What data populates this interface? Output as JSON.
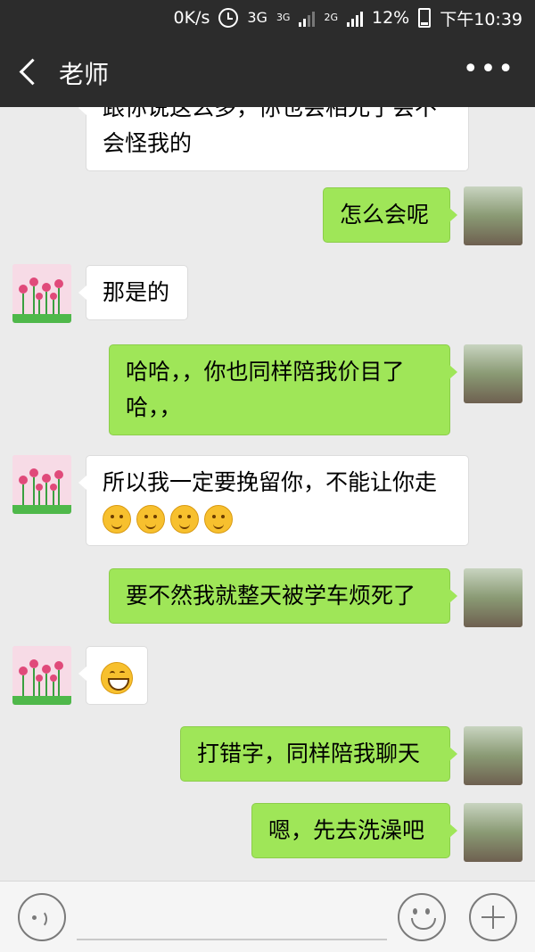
{
  "status_bar": {
    "net_speed": "0K/s",
    "net_a": "3G",
    "net_b": "3G",
    "net_c": "2G",
    "battery": "12%",
    "time": "下午10:39"
  },
  "header": {
    "title": "老师",
    "more": "•••"
  },
  "messages": [
    {
      "side": "in",
      "text_a": "跟你说这么多，你也会相允了会不",
      "text_b": "会怪我的"
    },
    {
      "side": "out",
      "text": "怎么会呢"
    },
    {
      "side": "in",
      "text": "那是的"
    },
    {
      "side": "out",
      "text_a": "哈哈，，你也同样陪我价目了",
      "text_b": "哈，，"
    },
    {
      "side": "in",
      "text": "所以我一定要挽留你，不能让你走",
      "emoji_count": 4,
      "emoji": "thinking-face"
    },
    {
      "side": "out",
      "text": "要不然我就整天被学车烦死了"
    },
    {
      "side": "in",
      "emoji": "grinning-face"
    },
    {
      "side": "out",
      "text": "打错字，同样陪我聊天"
    },
    {
      "side": "out",
      "text": "嗯，先去洗澡吧"
    }
  ],
  "colors": {
    "bar": "#2c2c2c",
    "chat_bg": "#ebebeb",
    "out_bubble": "#9fe658",
    "in_bubble": "#ffffff"
  }
}
